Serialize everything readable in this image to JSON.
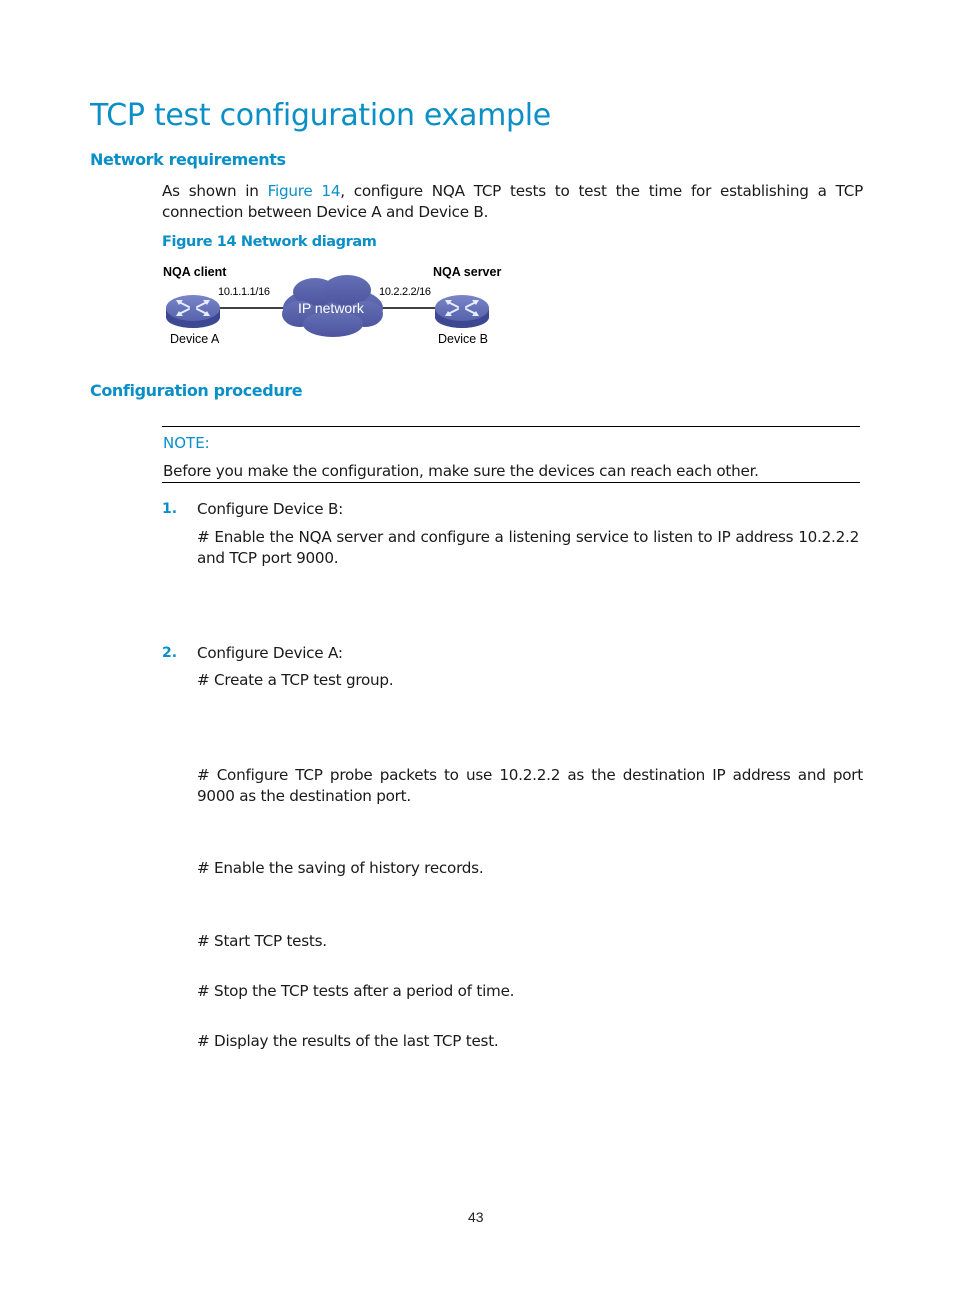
{
  "page": {
    "title": "TCP test configuration example",
    "page_number": "43"
  },
  "sections": {
    "network_requirements": {
      "heading": "Network requirements",
      "para_prefix": "As shown in ",
      "para_link": "Figure 14",
      "para_suffix": ", configure NQA TCP tests to test the time for establishing a TCP connection between Device A and Device B."
    },
    "figure": {
      "caption": "Figure 14 Network diagram",
      "client_role": "NQA client",
      "server_role": "NQA server",
      "client_ip": "10.1.1.1/16",
      "server_ip": "10.2.2.2/16",
      "cloud_label": "IP network",
      "device_a": "Device A",
      "device_b": "Device B",
      "colors": {
        "device": "#5b67b0",
        "cloud": "#5a62ab",
        "link": "#000000"
      }
    },
    "configuration_procedure": {
      "heading": "Configuration procedure",
      "note_label": "NOTE:",
      "note_text": "Before you make the configuration, make sure the devices can reach each other.",
      "steps": [
        {
          "number": "1.",
          "title": "Configure Device B:",
          "comments": [
            "# Enable the NQA server and configure a listening service to listen to IP address 10.2.2.2 and TCP port 9000."
          ]
        },
        {
          "number": "2.",
          "title": "Configure Device A:",
          "comments": [
            "# Create a TCP test group.",
            "# Configure TCP probe packets to use 10.2.2.2 as the destination IP address and port 9000 as the destination port.",
            "# Enable the saving of history records.",
            "# Start TCP tests.",
            "# Stop the TCP tests after a period of time.",
            "# Display the results of the last TCP test."
          ]
        }
      ]
    }
  },
  "colors": {
    "accent": "#0a8fc7",
    "text": "#1a1a1a"
  }
}
